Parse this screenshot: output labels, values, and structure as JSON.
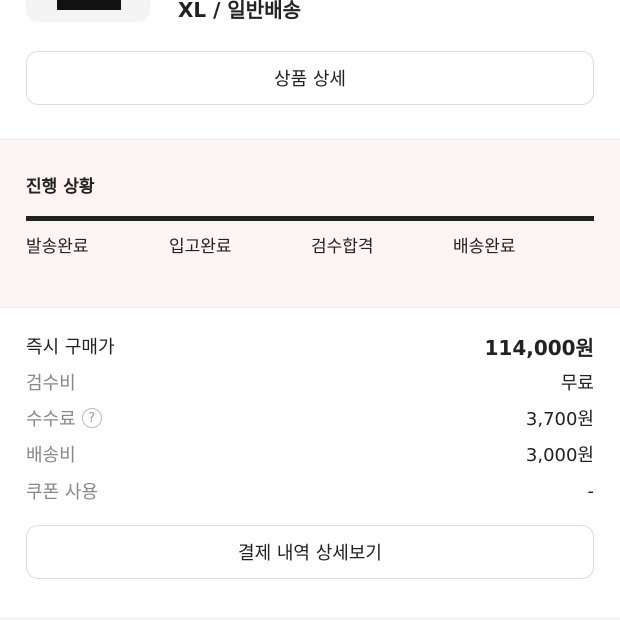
{
  "product": {
    "option_text": "XL / 일반배송"
  },
  "buttons": {
    "product_detail": "상품 상세",
    "payment_detail": "결제 내역 상세보기"
  },
  "progress": {
    "title": "진행 상황",
    "steps": [
      "발송완료",
      "입고완료",
      "검수합격",
      "배송완료"
    ],
    "completed_fraction": 1.0
  },
  "price": {
    "rows": [
      {
        "label": "즉시 구매가",
        "value": "114,000원"
      },
      {
        "label": "검수비",
        "value": "무료"
      },
      {
        "label": "수수료",
        "value": "3,700원",
        "help_icon": "question-circle-icon"
      },
      {
        "label": "배송비",
        "value": "3,000원"
      },
      {
        "label": "쿠폰 사용",
        "value": "-"
      }
    ]
  },
  "help_glyph": "?"
}
